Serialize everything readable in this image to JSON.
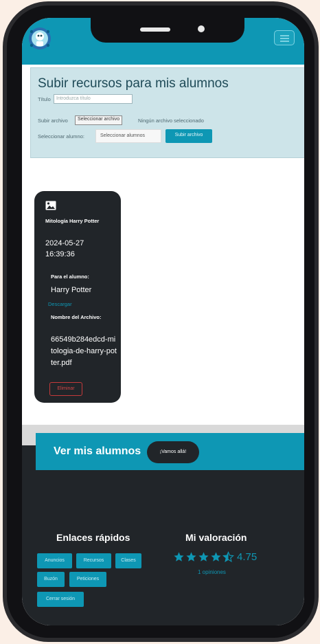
{
  "upload": {
    "title": "Subir recursos para mis alumnos",
    "title_label": "Título",
    "title_placeholder": "Introduzca título",
    "file_label": "Subir archivo",
    "file_button": "Seleccionar archivo",
    "file_status": "Ningún archivo seleccionado",
    "student_label": "Seleccionar alumno:",
    "student_select": "Seleccionar alumnos",
    "submit_button": "Subir archivo"
  },
  "resource": {
    "icon": "image-icon",
    "name": "Mitología Harry Potter",
    "datetime": "2024-05-27 16:39:36",
    "student_label": "Para el alumno:",
    "student": "Harry Potter",
    "download_link": "Descargar",
    "filename_label": "Nombre del Archivo:",
    "filename": "66549b284edcd-mitologia-de-harry-potter.pdf",
    "delete_button": "Eliminar"
  },
  "banner": {
    "text": "Ver mis alumnos",
    "button": "¡Vamos allá!"
  },
  "footer": {
    "links_title": "Enlaces rápidos",
    "links": [
      "Anuncios",
      "Recursos",
      "Clases",
      "Buzón",
      "Peticiones",
      "Cerrar sesión"
    ],
    "rating_title": "Mi valoración",
    "rating_value": "4.75",
    "rating_count": "1 opiniones"
  },
  "colors": {
    "accent": "#0e97b4",
    "dark": "#212529",
    "upload_bg": "#cde4e9",
    "danger": "#c53a3a",
    "page_bg": "#fbefe6"
  }
}
